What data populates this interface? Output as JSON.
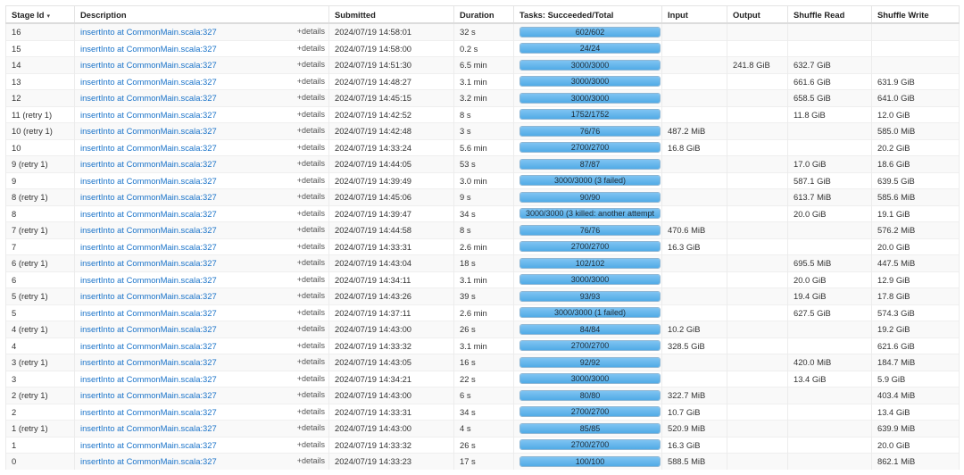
{
  "table": {
    "headers": {
      "stage_id": "Stage Id",
      "sort_indicator": "▾",
      "description": "Description",
      "submitted": "Submitted",
      "duration": "Duration",
      "tasks": "Tasks: Succeeded/Total",
      "input": "Input",
      "output": "Output",
      "shuffle_read": "Shuffle Read",
      "shuffle_write": "Shuffle Write"
    },
    "rows": [
      {
        "stage_id": "16",
        "description": "insertInto at CommonMain.scala:327",
        "details": "+details",
        "submitted": "2024/07/19 14:58:01",
        "duration": "32 s",
        "tasks_text": "602/602",
        "tasks_progress": 1.0,
        "input": "",
        "output": "",
        "shuffle_read": "",
        "shuffle_write": ""
      },
      {
        "stage_id": "15",
        "description": "insertInto at CommonMain.scala:327",
        "details": "+details",
        "submitted": "2024/07/19 14:58:00",
        "duration": "0.2 s",
        "tasks_text": "24/24",
        "tasks_progress": 1.0,
        "input": "",
        "output": "",
        "shuffle_read": "",
        "shuffle_write": ""
      },
      {
        "stage_id": "14",
        "description": "insertInto at CommonMain.scala:327",
        "details": "+details",
        "submitted": "2024/07/19 14:51:30",
        "duration": "6.5 min",
        "tasks_text": "3000/3000",
        "tasks_progress": 1.0,
        "input": "",
        "output": "241.8 GiB",
        "shuffle_read": "632.7 GiB",
        "shuffle_write": ""
      },
      {
        "stage_id": "13",
        "description": "insertInto at CommonMain.scala:327",
        "details": "+details",
        "submitted": "2024/07/19 14:48:27",
        "duration": "3.1 min",
        "tasks_text": "3000/3000",
        "tasks_progress": 1.0,
        "input": "",
        "output": "",
        "shuffle_read": "661.6 GiB",
        "shuffle_write": "631.9 GiB"
      },
      {
        "stage_id": "12",
        "description": "insertInto at CommonMain.scala:327",
        "details": "+details",
        "submitted": "2024/07/19 14:45:15",
        "duration": "3.2 min",
        "tasks_text": "3000/3000",
        "tasks_progress": 1.0,
        "input": "",
        "output": "",
        "shuffle_read": "658.5 GiB",
        "shuffle_write": "641.0 GiB"
      },
      {
        "stage_id": "11 (retry 1)",
        "description": "insertInto at CommonMain.scala:327",
        "details": "+details",
        "submitted": "2024/07/19 14:42:52",
        "duration": "8 s",
        "tasks_text": "1752/1752",
        "tasks_progress": 1.0,
        "input": "",
        "output": "",
        "shuffle_read": "11.8 GiB",
        "shuffle_write": "12.0 GiB"
      },
      {
        "stage_id": "10 (retry 1)",
        "description": "insertInto at CommonMain.scala:327",
        "details": "+details",
        "submitted": "2024/07/19 14:42:48",
        "duration": "3 s",
        "tasks_text": "76/76",
        "tasks_progress": 1.0,
        "input": "487.2 MiB",
        "output": "",
        "shuffle_read": "",
        "shuffle_write": "585.0 MiB"
      },
      {
        "stage_id": "10",
        "description": "insertInto at CommonMain.scala:327",
        "details": "+details",
        "submitted": "2024/07/19 14:33:24",
        "duration": "5.6 min",
        "tasks_text": "2700/2700",
        "tasks_progress": 1.0,
        "input": "16.8 GiB",
        "output": "",
        "shuffle_read": "",
        "shuffle_write": "20.2 GiB"
      },
      {
        "stage_id": "9 (retry 1)",
        "description": "insertInto at CommonMain.scala:327",
        "details": "+details",
        "submitted": "2024/07/19 14:44:05",
        "duration": "53 s",
        "tasks_text": "87/87",
        "tasks_progress": 1.0,
        "input": "",
        "output": "",
        "shuffle_read": "17.0 GiB",
        "shuffle_write": "18.6 GiB"
      },
      {
        "stage_id": "9",
        "description": "insertInto at CommonMain.scala:327",
        "details": "+details",
        "submitted": "2024/07/19 14:39:49",
        "duration": "3.0 min",
        "tasks_text": "3000/3000 (3 failed)",
        "tasks_progress": 1.0,
        "input": "",
        "output": "",
        "shuffle_read": "587.1 GiB",
        "shuffle_write": "639.5 GiB"
      },
      {
        "stage_id": "8 (retry 1)",
        "description": "insertInto at CommonMain.scala:327",
        "details": "+details",
        "submitted": "2024/07/19 14:45:06",
        "duration": "9 s",
        "tasks_text": "90/90",
        "tasks_progress": 1.0,
        "input": "",
        "output": "",
        "shuffle_read": "613.7 MiB",
        "shuffle_write": "585.6 MiB"
      },
      {
        "stage_id": "8",
        "description": "insertInto at CommonMain.scala:327",
        "details": "+details",
        "submitted": "2024/07/19 14:39:47",
        "duration": "34 s",
        "tasks_text": "3000/3000 (3 killed: another attempt",
        "tasks_progress": 1.0,
        "input": "",
        "output": "",
        "shuffle_read": "20.0 GiB",
        "shuffle_write": "19.1 GiB"
      },
      {
        "stage_id": "7 (retry 1)",
        "description": "insertInto at CommonMain.scala:327",
        "details": "+details",
        "submitted": "2024/07/19 14:44:58",
        "duration": "8 s",
        "tasks_text": "76/76",
        "tasks_progress": 1.0,
        "input": "470.6 MiB",
        "output": "",
        "shuffle_read": "",
        "shuffle_write": "576.2 MiB"
      },
      {
        "stage_id": "7",
        "description": "insertInto at CommonMain.scala:327",
        "details": "+details",
        "submitted": "2024/07/19 14:33:31",
        "duration": "2.6 min",
        "tasks_text": "2700/2700",
        "tasks_progress": 1.0,
        "input": "16.3 GiB",
        "output": "",
        "shuffle_read": "",
        "shuffle_write": "20.0 GiB"
      },
      {
        "stage_id": "6 (retry 1)",
        "description": "insertInto at CommonMain.scala:327",
        "details": "+details",
        "submitted": "2024/07/19 14:43:04",
        "duration": "18 s",
        "tasks_text": "102/102",
        "tasks_progress": 1.0,
        "input": "",
        "output": "",
        "shuffle_read": "695.5 MiB",
        "shuffle_write": "447.5 MiB"
      },
      {
        "stage_id": "6",
        "description": "insertInto at CommonMain.scala:327",
        "details": "+details",
        "submitted": "2024/07/19 14:34:11",
        "duration": "3.1 min",
        "tasks_text": "3000/3000",
        "tasks_progress": 1.0,
        "input": "",
        "output": "",
        "shuffle_read": "20.0 GiB",
        "shuffle_write": "12.9 GiB"
      },
      {
        "stage_id": "5 (retry 1)",
        "description": "insertInto at CommonMain.scala:327",
        "details": "+details",
        "submitted": "2024/07/19 14:43:26",
        "duration": "39 s",
        "tasks_text": "93/93",
        "tasks_progress": 1.0,
        "input": "",
        "output": "",
        "shuffle_read": "19.4 GiB",
        "shuffle_write": "17.8 GiB"
      },
      {
        "stage_id": "5",
        "description": "insertInto at CommonMain.scala:327",
        "details": "+details",
        "submitted": "2024/07/19 14:37:11",
        "duration": "2.6 min",
        "tasks_text": "3000/3000 (1 failed)",
        "tasks_progress": 1.0,
        "input": "",
        "output": "",
        "shuffle_read": "627.5 GiB",
        "shuffle_write": "574.3 GiB"
      },
      {
        "stage_id": "4 (retry 1)",
        "description": "insertInto at CommonMain.scala:327",
        "details": "+details",
        "submitted": "2024/07/19 14:43:00",
        "duration": "26 s",
        "tasks_text": "84/84",
        "tasks_progress": 1.0,
        "input": "10.2 GiB",
        "output": "",
        "shuffle_read": "",
        "shuffle_write": "19.2 GiB"
      },
      {
        "stage_id": "4",
        "description": "insertInto at CommonMain.scala:327",
        "details": "+details",
        "submitted": "2024/07/19 14:33:32",
        "duration": "3.1 min",
        "tasks_text": "2700/2700",
        "tasks_progress": 1.0,
        "input": "328.5 GiB",
        "output": "",
        "shuffle_read": "",
        "shuffle_write": "621.6 GiB"
      },
      {
        "stage_id": "3 (retry 1)",
        "description": "insertInto at CommonMain.scala:327",
        "details": "+details",
        "submitted": "2024/07/19 14:43:05",
        "duration": "16 s",
        "tasks_text": "92/92",
        "tasks_progress": 1.0,
        "input": "",
        "output": "",
        "shuffle_read": "420.0 MiB",
        "shuffle_write": "184.7 MiB"
      },
      {
        "stage_id": "3",
        "description": "insertInto at CommonMain.scala:327",
        "details": "+details",
        "submitted": "2024/07/19 14:34:21",
        "duration": "22 s",
        "tasks_text": "3000/3000",
        "tasks_progress": 1.0,
        "input": "",
        "output": "",
        "shuffle_read": "13.4 GiB",
        "shuffle_write": "5.9 GiB"
      },
      {
        "stage_id": "2 (retry 1)",
        "description": "insertInto at CommonMain.scala:327",
        "details": "+details",
        "submitted": "2024/07/19 14:43:00",
        "duration": "6 s",
        "tasks_text": "80/80",
        "tasks_progress": 1.0,
        "input": "322.7 MiB",
        "output": "",
        "shuffle_read": "",
        "shuffle_write": "403.4 MiB"
      },
      {
        "stage_id": "2",
        "description": "insertInto at CommonMain.scala:327",
        "details": "+details",
        "submitted": "2024/07/19 14:33:31",
        "duration": "34 s",
        "tasks_text": "2700/2700",
        "tasks_progress": 1.0,
        "input": "10.7 GiB",
        "output": "",
        "shuffle_read": "",
        "shuffle_write": "13.4 GiB"
      },
      {
        "stage_id": "1 (retry 1)",
        "description": "insertInto at CommonMain.scala:327",
        "details": "+details",
        "submitted": "2024/07/19 14:43:00",
        "duration": "4 s",
        "tasks_text": "85/85",
        "tasks_progress": 1.0,
        "input": "520.9 MiB",
        "output": "",
        "shuffle_read": "",
        "shuffle_write": "639.9 MiB"
      },
      {
        "stage_id": "1",
        "description": "insertInto at CommonMain.scala:327",
        "details": "+details",
        "submitted": "2024/07/19 14:33:32",
        "duration": "26 s",
        "tasks_text": "2700/2700",
        "tasks_progress": 1.0,
        "input": "16.3 GiB",
        "output": "",
        "shuffle_read": "",
        "shuffle_write": "20.0 GiB"
      },
      {
        "stage_id": "0",
        "description": "insertInto at CommonMain.scala:327",
        "details": "+details",
        "submitted": "2024/07/19 14:33:23",
        "duration": "17 s",
        "tasks_text": "100/100",
        "tasks_progress": 1.0,
        "input": "588.5 MiB",
        "output": "",
        "shuffle_read": "",
        "shuffle_write": "862.1 MiB"
      }
    ]
  }
}
